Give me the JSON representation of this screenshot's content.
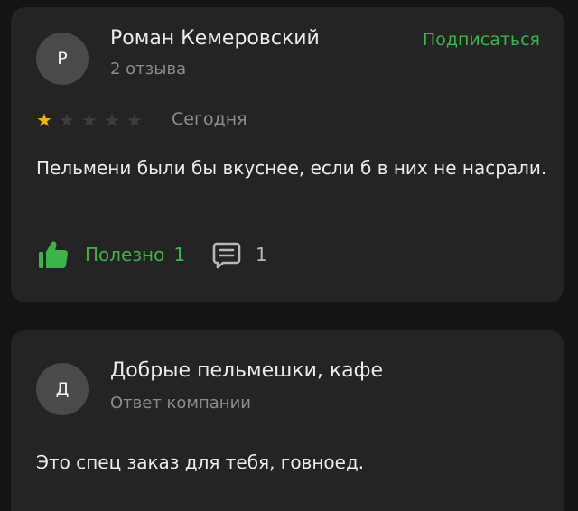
{
  "review": {
    "avatar_letter": "Р",
    "author": "Роман Кемеровский",
    "reviews_count": "2 отзыва",
    "subscribe_label": "Подписаться",
    "rating": 1,
    "rating_max": 5,
    "date": "Сегодня",
    "text": "Пельмени были бы вкуснее, если б в них не насрали.",
    "helpful_label": "Полезно",
    "helpful_count": "1",
    "comments_count": "1"
  },
  "reply": {
    "avatar_letter": "Д",
    "company": "Добрые пельмешки, кафе",
    "label": "Ответ компании",
    "text": "Это спец заказ для тебя, говноед."
  },
  "colors": {
    "accent_green": "#38b648",
    "star_filled": "#f5b800",
    "star_empty": "#3d3d3d"
  },
  "icons": {
    "thumb": "thumbs-up-icon",
    "comment": "comment-icon",
    "star": "star-icon"
  }
}
